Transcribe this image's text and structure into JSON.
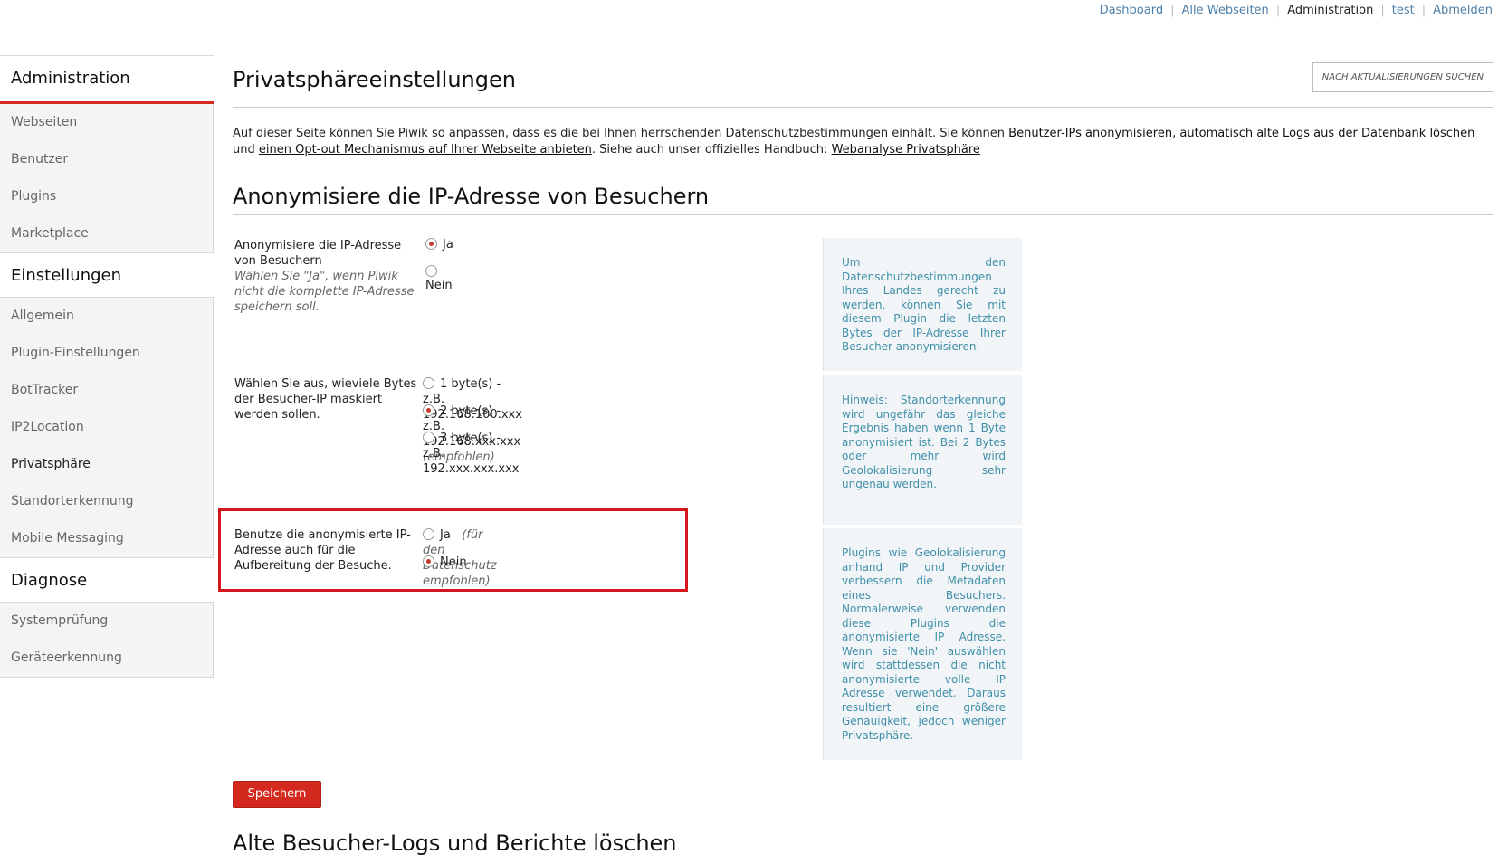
{
  "topnav": {
    "items": [
      {
        "label": "Dashboard",
        "current": false
      },
      {
        "label": "Alle Webseiten",
        "current": false
      },
      {
        "label": "Administration",
        "current": true
      },
      {
        "label": "test",
        "current": false
      },
      {
        "label": "Abmelden",
        "current": false
      }
    ],
    "separator": "|"
  },
  "sidebar": {
    "admin_title": "Administration",
    "admin_items": [
      "Webseiten",
      "Benutzer",
      "Plugins",
      "Marketplace"
    ],
    "settings_title": "Einstellungen",
    "settings_items": [
      "Allgemein",
      "Plugin-Einstellungen",
      "BotTracker",
      "IP2Location",
      "Privatsphäre",
      "Standorterkennung",
      "Mobile Messaging"
    ],
    "selected": "Privatsphäre",
    "diag_title": "Diagnose",
    "diag_items": [
      "Systemprüfung",
      "Geräteerkennung"
    ]
  },
  "main": {
    "title": "Privatsphäreeinstellungen",
    "update_button": "Nach Aktualisierungen suchen",
    "intro": {
      "t1": "Auf dieser Seite können Sie Piwik so anpassen, dass es die bei Ihnen herrschenden Datenschutzbestimmungen einhält. Sie können ",
      "link1": "Benutzer-IPs anonymisieren",
      "t2": ", ",
      "link2": "automatisch alte Logs aus der Datenbank löschen",
      "t3": " und ",
      "link3": "einen Opt-out Mechanismus auf Ihrer Webseite anbieten",
      "t4": ". Siehe auch unser offizielles Handbuch: ",
      "link4": "Webanalyse Privatsphäre"
    },
    "section_anon": "Anonymisiere die IP-Adresse von Besuchern",
    "q1": {
      "label": "Anonymisiere die IP-Adresse von Besuchern",
      "help": "Wählen Sie \"Ja\", wenn Piwik nicht die komplette IP-Adresse speichern soll.",
      "yes": "Ja",
      "no": "Nein",
      "selected": "Ja"
    },
    "q2": {
      "label": "Wählen Sie aus, wieviele Bytes der Besucher-IP maskiert werden sollen.",
      "options": [
        {
          "text": "1 byte(s) - z.B. 192.168.100.xxx",
          "note": "",
          "selected": false
        },
        {
          "text": "2 byte(s) - z.B. 192.168.xxx.xxx",
          "note": "(empfohlen)",
          "selected": true
        },
        {
          "text": "3 byte(s) - z.B. 192.xxx.xxx.xxx",
          "note": "",
          "selected": false
        }
      ]
    },
    "q3": {
      "label": "Benutze die anonymisierte IP-Adresse auch für die Aufbereitung der Besuche.",
      "yes": "Ja",
      "yes_note": "(für den Datenschutz empfohlen)",
      "no": "Nein",
      "selected": "Nein"
    },
    "info1": "Um den Datenschutzbestimmungen Ihres Landes gerecht zu werden, können Sie mit diesem Plugin die letzten Bytes der IP-Adresse Ihrer Besucher anonymisieren.",
    "info2": "Hinweis: Standorterkennung wird ungefähr das gleiche Ergebnis haben wenn 1 Byte anonymisiert ist. Bei 2 Bytes oder mehr wird Geolokalisierung sehr ungenau werden.",
    "info3": "Plugins wie Geolokalisierung anhand IP und Provider verbessern die Metadaten eines Besuchers. Normalerweise verwenden diese Plugins die anonymisierte IP Adresse. Wenn sie 'Nein' auswählen wird stattdessen die nicht anonymisierte volle IP Adresse verwendet. Daraus resultiert eine größere Genauigkeit, jedoch weniger Privatsphäre.",
    "save_button": "Speichern",
    "section_logs": "Alte Besucher-Logs und Berichte löschen"
  },
  "colors": {
    "accent": "#d4291f",
    "info_text": "#3f8fa8",
    "info_bg": "#f2f5f8",
    "link": "#4d7fa8"
  }
}
